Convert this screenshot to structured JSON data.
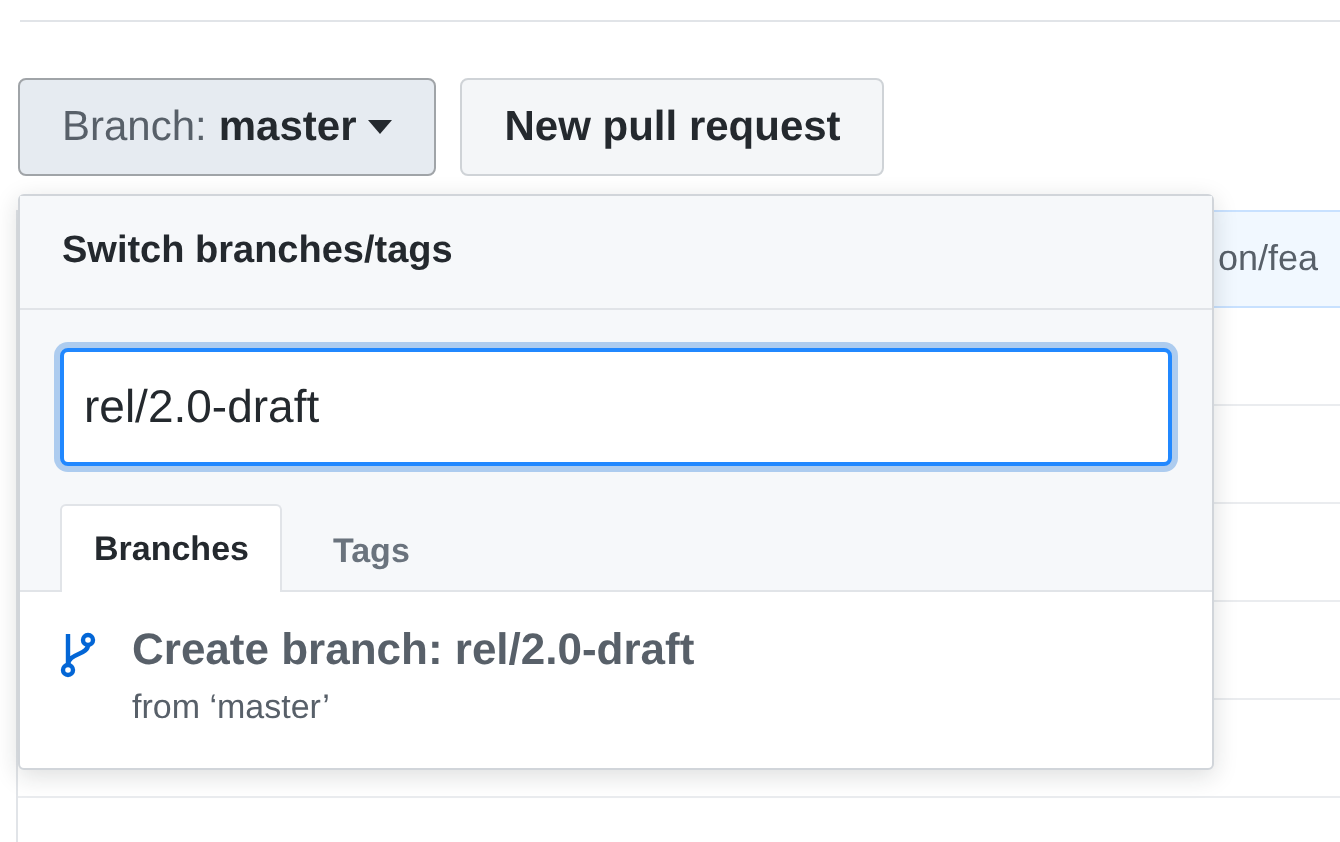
{
  "branch_button": {
    "label": "Branch:",
    "value": "master"
  },
  "new_pull_request": "New pull request",
  "file_table": {
    "header_text": "on/fea"
  },
  "dropdown": {
    "title": "Switch branches/tags",
    "filter": {
      "value": "rel/2.0-draft"
    },
    "tabs": [
      {
        "label": "Branches",
        "selected": true
      },
      {
        "label": "Tags",
        "selected": false
      }
    ],
    "create_item": {
      "title": "Create branch: rel/2.0-draft",
      "subtitle": "from ‘master’"
    }
  }
}
